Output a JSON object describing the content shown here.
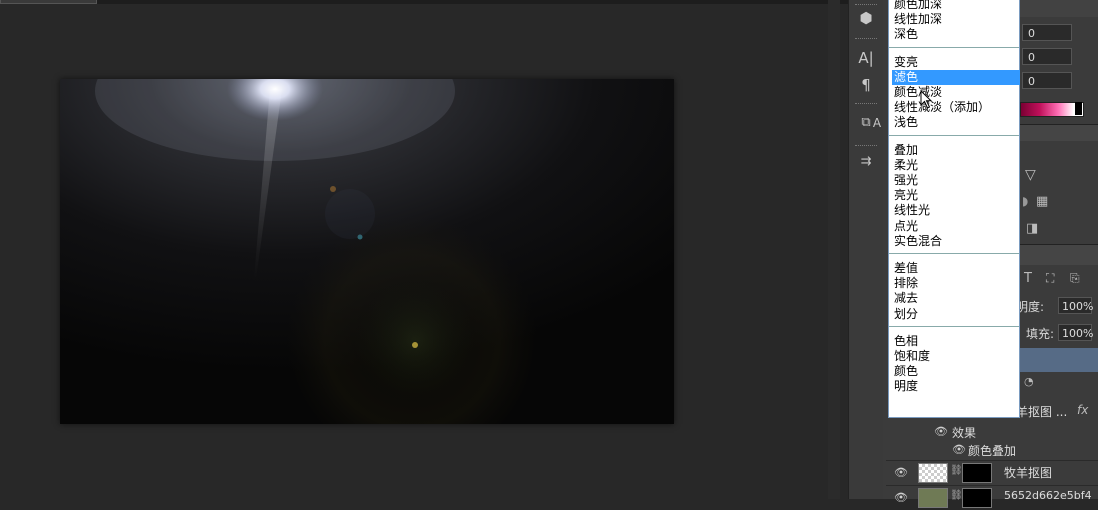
{
  "blend_modes": {
    "groups": [
      [
        "颜色加深",
        "线性加深",
        "深色"
      ],
      [
        "变亮",
        "滤色",
        "颜色减淡",
        "线性减淡（添加）",
        "浅色"
      ],
      [
        "叠加",
        "柔光",
        "强光",
        "亮光",
        "线性光",
        "点光",
        "实色混合"
      ],
      [
        "差值",
        "排除",
        "减去",
        "划分"
      ],
      [
        "色相",
        "饱和度",
        "颜色",
        "明度"
      ]
    ],
    "selected": "滤色"
  },
  "properties": {
    "values": [
      "0",
      "0",
      "0"
    ]
  },
  "layers_panel": {
    "opacity_label": "透明度:",
    "opacity_label_visible": "透明度:",
    "opacity_value": "100%",
    "fill_label": "填充:",
    "fill_value": "100%",
    "fx_label": "fx",
    "partial_layer_name": "牧羊抠图 ...",
    "effects_label": "效果",
    "effect_item": "颜色叠加",
    "layers": [
      {
        "name": "牧羊抠图"
      },
      {
        "name": "5652d662e5bf4"
      }
    ]
  },
  "tools": {
    "icons": [
      "3d-cube-icon",
      "character-icon",
      "paragraph-icon",
      "character-style-icon",
      "paragraph-style-icon",
      "align-icon"
    ]
  },
  "colors": {
    "highlight": "#3399ff",
    "selected_layer": "#566b86",
    "panel_bg": "#3b3b3b",
    "workspace_bg": "#282828"
  }
}
